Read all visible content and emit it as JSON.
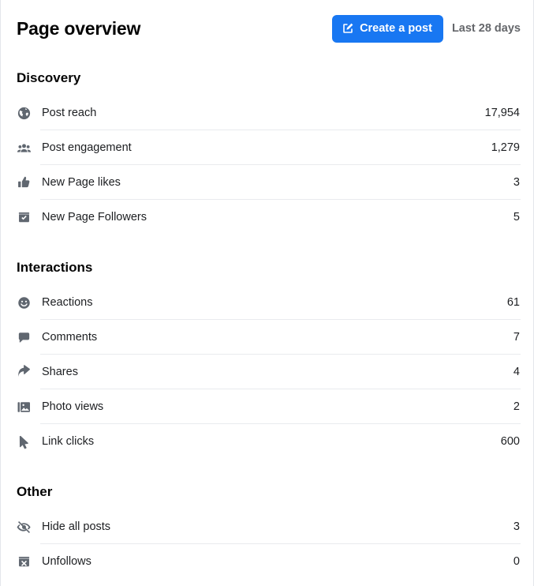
{
  "header": {
    "title": "Page overview",
    "create_post_label": "Create a post",
    "create_post_icon": "compose-square-pencil-icon",
    "date_range": "Last 28 days",
    "accent_color": "#1877f2"
  },
  "sections": [
    {
      "id": "discovery",
      "title": "Discovery",
      "rows": [
        {
          "icon": "globe-icon",
          "label": "Post reach",
          "value": "17,954"
        },
        {
          "icon": "people-group-icon",
          "label": "Post engagement",
          "value": "1,279"
        },
        {
          "icon": "thumbs-up-icon",
          "label": "New Page likes",
          "value": "3"
        },
        {
          "icon": "badge-check-icon",
          "label": "New Page Followers",
          "value": "5"
        }
      ]
    },
    {
      "id": "interactions",
      "title": "Interactions",
      "rows": [
        {
          "icon": "smiley-face-icon",
          "label": "Reactions",
          "value": "61"
        },
        {
          "icon": "speech-bubble-icon",
          "label": "Comments",
          "value": "7"
        },
        {
          "icon": "share-arrow-icon",
          "label": "Shares",
          "value": "4"
        },
        {
          "icon": "photo-icon",
          "label": "Photo views",
          "value": "2"
        },
        {
          "icon": "cursor-pointer-icon",
          "label": "Link clicks",
          "value": "600"
        }
      ]
    },
    {
      "id": "other",
      "title": "Other",
      "rows": [
        {
          "icon": "eye-slash-icon",
          "label": "Hide all posts",
          "value": "3"
        },
        {
          "icon": "badge-x-icon",
          "label": "Unfollows",
          "value": "0"
        }
      ]
    }
  ]
}
